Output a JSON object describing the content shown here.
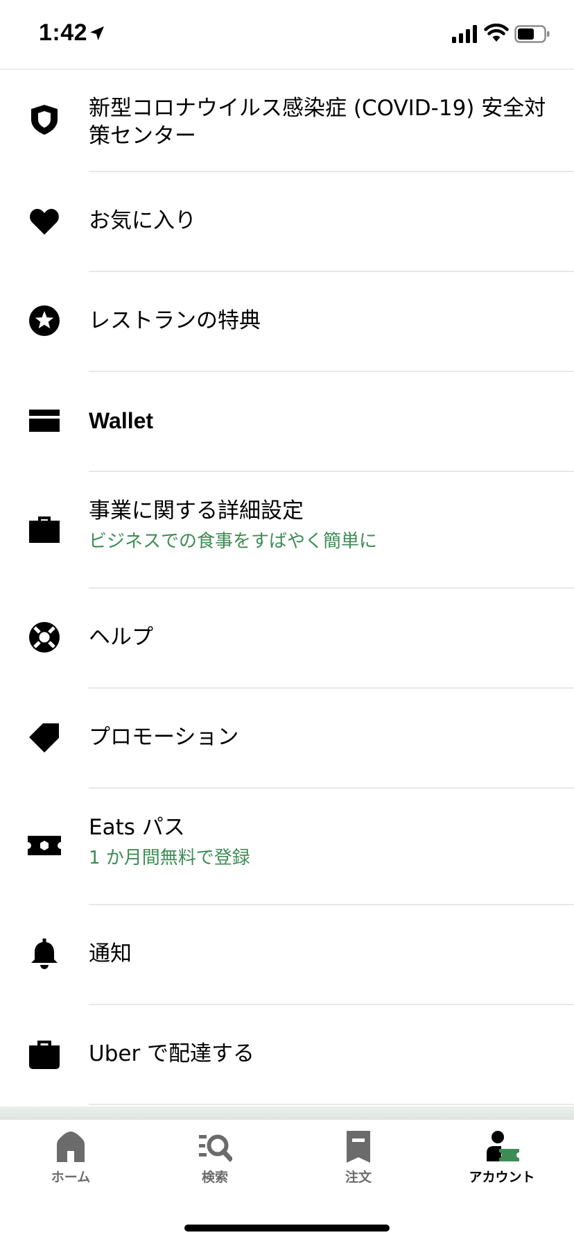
{
  "status_bar": {
    "time": "1:42",
    "icons": [
      "location-arrow-icon",
      "cellular-signal-icon",
      "wifi-icon",
      "battery-icon"
    ]
  },
  "menu": {
    "items": [
      {
        "icon": "shield-icon",
        "label": "新型コロナウイルス感染症 (COVID-19) 安全対策センター"
      },
      {
        "icon": "heart-icon",
        "label": "お気に入り"
      },
      {
        "icon": "star-badge-icon",
        "label": "レストランの特典"
      },
      {
        "icon": "wallet-card-icon",
        "label": "Wallet"
      },
      {
        "icon": "briefcase-icon",
        "label": "事業に関する詳細設定",
        "sublabel": "ビジネスでの食事をすばやく簡単に"
      },
      {
        "icon": "lifebuoy-icon",
        "label": "ヘルプ"
      },
      {
        "icon": "tag-icon",
        "label": "プロモーション"
      },
      {
        "icon": "ticket-icon",
        "label": "Eats パス",
        "sublabel": "1 か月間無料で登録"
      },
      {
        "icon": "bell-icon",
        "label": "通知"
      },
      {
        "icon": "delivery-bag-icon",
        "label": "Uber で配達する"
      }
    ]
  },
  "tabbar": {
    "tabs": [
      {
        "icon": "home-icon",
        "label": "ホーム",
        "active": false
      },
      {
        "icon": "search-icon",
        "label": "検索",
        "active": false
      },
      {
        "icon": "receipt-icon",
        "label": "注文",
        "active": false
      },
      {
        "icon": "account-icon",
        "label": "アカウント",
        "active": true
      }
    ]
  },
  "colors": {
    "accent_green": "#3d8c54",
    "inactive_tab": "#6b6b6b",
    "divider": "#e8e8e8"
  }
}
